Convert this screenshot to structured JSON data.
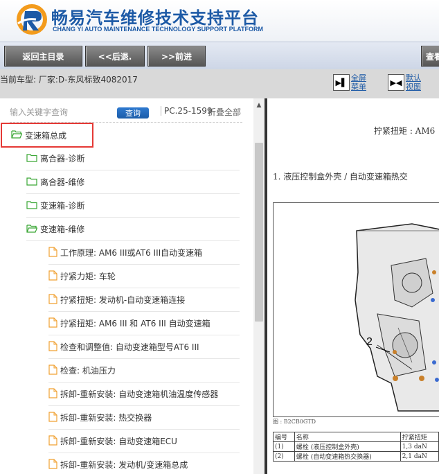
{
  "header": {
    "brand_cn": "畅易汽车维修技术支持平台",
    "brand_en": "CHANG YI AUTO MAINTENANCE TECHNOLOGY SUPPORT PLATFORM",
    "brand_color": "#1d5aa6"
  },
  "nav": {
    "home_label": "返回主目录",
    "back_label": "<<后退.",
    "forward_label": ">>前进",
    "search_label": "查看"
  },
  "subbar": {
    "current_model": "当前车型:  厂家:D-东风标致4082017",
    "fullscreen_label": "全屏菜单",
    "default_view_label": "默认视图"
  },
  "sidebar": {
    "search_placeholder": "输入关键字查询",
    "search_button": "查询",
    "pc_code": "PC.25-1599",
    "collapse_all": "折叠全部",
    "items": [
      {
        "label": "变速箱总成",
        "icon": "folder-open-icon",
        "selected": true
      },
      {
        "label": "离合器-诊断",
        "icon": "folder-icon"
      },
      {
        "label": "离合器-维修",
        "icon": "folder-icon"
      },
      {
        "label": "变速箱-诊断",
        "icon": "folder-icon"
      },
      {
        "label": "变速箱-维修",
        "icon": "folder-open-icon"
      },
      {
        "label": "工作原理: AM6 III或AT6 III自动变速箱",
        "icon": "document-icon"
      },
      {
        "label": "拧紧力矩: 车轮",
        "icon": "document-icon"
      },
      {
        "label": "拧紧扭矩: 发动机-自动变速箱连接",
        "icon": "document-icon"
      },
      {
        "label": "拧紧扭矩: AM6 III 和 AT6 III 自动变速箱",
        "icon": "document-icon"
      },
      {
        "label": "检查和调整值: 自动变速箱型号AT6 III",
        "icon": "document-icon"
      },
      {
        "label": "检查: 机油压力",
        "icon": "document-icon"
      },
      {
        "label": "拆卸-重新安装: 自动变速箱机油温度传感器",
        "icon": "document-icon"
      },
      {
        "label": "拆卸-重新安装: 热交换器",
        "icon": "document-icon"
      },
      {
        "label": "拆卸-重新安装: 自动变速箱ECU",
        "icon": "document-icon"
      },
      {
        "label": "拆卸-重新安装: 发动机/变速箱总成",
        "icon": "document-icon"
      }
    ]
  },
  "content": {
    "torque_title": "拧紧扭矩 : AM6",
    "section_heading": "1. 液压控制盒外壳 / 自动变速箱热交",
    "figure_callout": "2",
    "figure_caption": "图 : B2CB0GTD",
    "table": {
      "headers": [
        "编号",
        "名称",
        "拧紧扭矩"
      ],
      "rows": [
        [
          "(1)",
          "螺栓 (液压控制盒外壳)",
          "1,3 daN"
        ],
        [
          "(2)",
          "螺栓 (自动变速箱热交换器)",
          "2,1 daN"
        ]
      ]
    }
  },
  "colors": {
    "selection_outline": "#e53935",
    "folder_green": "#3aa635",
    "document_orange": "#f0a030"
  }
}
